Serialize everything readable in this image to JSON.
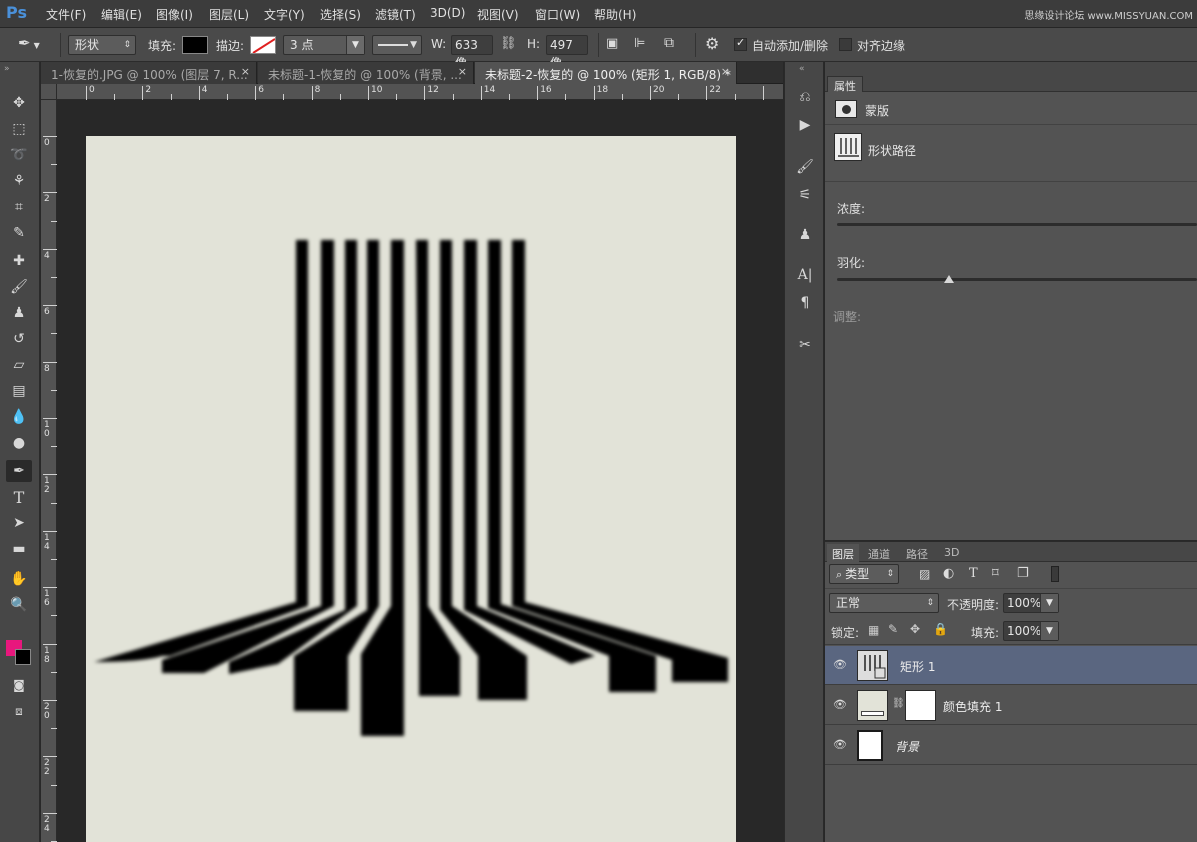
{
  "app": {
    "logo": "Ps",
    "watermark": "思缘设计论坛 www.MISSYUAN.COM"
  },
  "menu": [
    "文件(F)",
    "编辑(E)",
    "图像(I)",
    "图层(L)",
    "文字(Y)",
    "选择(S)",
    "滤镜(T)",
    "3D(D)",
    "视图(V)",
    "窗口(W)",
    "帮助(H)"
  ],
  "options": {
    "mode": "形状",
    "fill_label": "填充:",
    "stroke_label": "描边:",
    "stroke_width": "3 点",
    "w_label": "W:",
    "w_value": "633 像",
    "h_label": "H:",
    "h_value": "497 像",
    "auto_add_delete": "自动添加/删除",
    "align_edges": "对齐边缘",
    "fill_color": "#000000"
  },
  "tabs": [
    {
      "label": "1-恢复的.JPG @ 100% (图层 7, R...",
      "close": "×"
    },
    {
      "label": "未标题-1-恢复的 @ 100% (背景, ...",
      "close": "×"
    },
    {
      "label": "未标题-2-恢复的 @ 100% (矩形 1, RGB/8) *",
      "close": "×"
    }
  ],
  "ruler": {
    "h_ticks": [
      "0",
      "2",
      "4",
      "6",
      "8",
      "10",
      "12",
      "14",
      "16",
      "18",
      "20",
      "22"
    ],
    "v_ticks": [
      "0",
      "2",
      "4",
      "6",
      "8",
      "10",
      "12",
      "14",
      "16",
      "18",
      "20",
      "22",
      "24"
    ]
  },
  "canvas": {
    "background": "#e2e3d8"
  },
  "colors": {
    "foreground": "#e8177d",
    "background": "#000000"
  },
  "properties": {
    "tab": "属性",
    "mask_label": "蒙版",
    "shape_path_label": "形状路径",
    "density_label": "浓度:",
    "feather_label": "羽化:",
    "adjust_label": "调整:",
    "feather_level_percent": 31
  },
  "layers": {
    "tabs": [
      "图层",
      "通道",
      "路径",
      "3D"
    ],
    "filter_kind": "类型",
    "blend_mode": "正常",
    "opacity_label": "不透明度:",
    "opacity_value": "100%",
    "lock_label": "锁定:",
    "fill_label": "填充:",
    "fill_value": "100%",
    "items": [
      {
        "name": "矩形 1",
        "selected": true
      },
      {
        "name": "颜色填充 1",
        "selected": false
      },
      {
        "name": "背景",
        "selected": false
      }
    ]
  }
}
